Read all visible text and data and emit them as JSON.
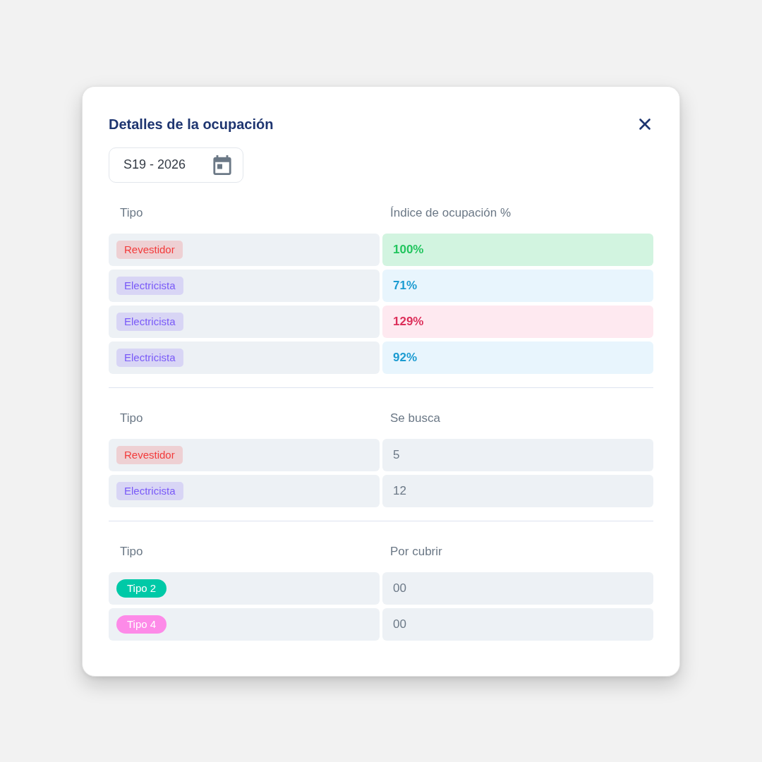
{
  "dialog": {
    "title": "Detalles de la ocupación"
  },
  "week_field": {
    "value": "S19 - 2026"
  },
  "sections": [
    {
      "columns": [
        "Tipo",
        "Índice de ocupación %"
      ],
      "rows": [
        {
          "tag": {
            "label": "Revestidor",
            "kind": "soft",
            "color": "#f23b3b"
          },
          "value": "100%",
          "kind": "good"
        },
        {
          "tag": {
            "label": "Electricista",
            "kind": "soft",
            "color": "#7a5af8"
          },
          "value": "71%",
          "kind": "low"
        },
        {
          "tag": {
            "label": "Electricista",
            "kind": "soft",
            "color": "#7a5af8"
          },
          "value": "129%",
          "kind": "over"
        },
        {
          "tag": {
            "label": "Electricista",
            "kind": "soft",
            "color": "#7a5af8"
          },
          "value": "92%",
          "kind": "low"
        }
      ]
    },
    {
      "columns": [
        "Tipo",
        "Se busca"
      ],
      "rows": [
        {
          "tag": {
            "label": "Revestidor",
            "kind": "soft",
            "color": "#f23b3b"
          },
          "value": "5",
          "kind": "plain"
        },
        {
          "tag": {
            "label": "Electricista",
            "kind": "soft",
            "color": "#7a5af8"
          },
          "value": "12",
          "kind": "plain"
        }
      ]
    },
    {
      "columns": [
        "Tipo",
        "Por cubrir"
      ],
      "rows": [
        {
          "tag": {
            "label": "Tipo 2",
            "kind": "pill",
            "color": "#00c9a7"
          },
          "value": "00",
          "kind": "plain"
        },
        {
          "tag": {
            "label": "Tipo 4",
            "kind": "pill",
            "color": "#fd8ae8"
          },
          "value": "00",
          "kind": "plain"
        }
      ]
    }
  ]
}
